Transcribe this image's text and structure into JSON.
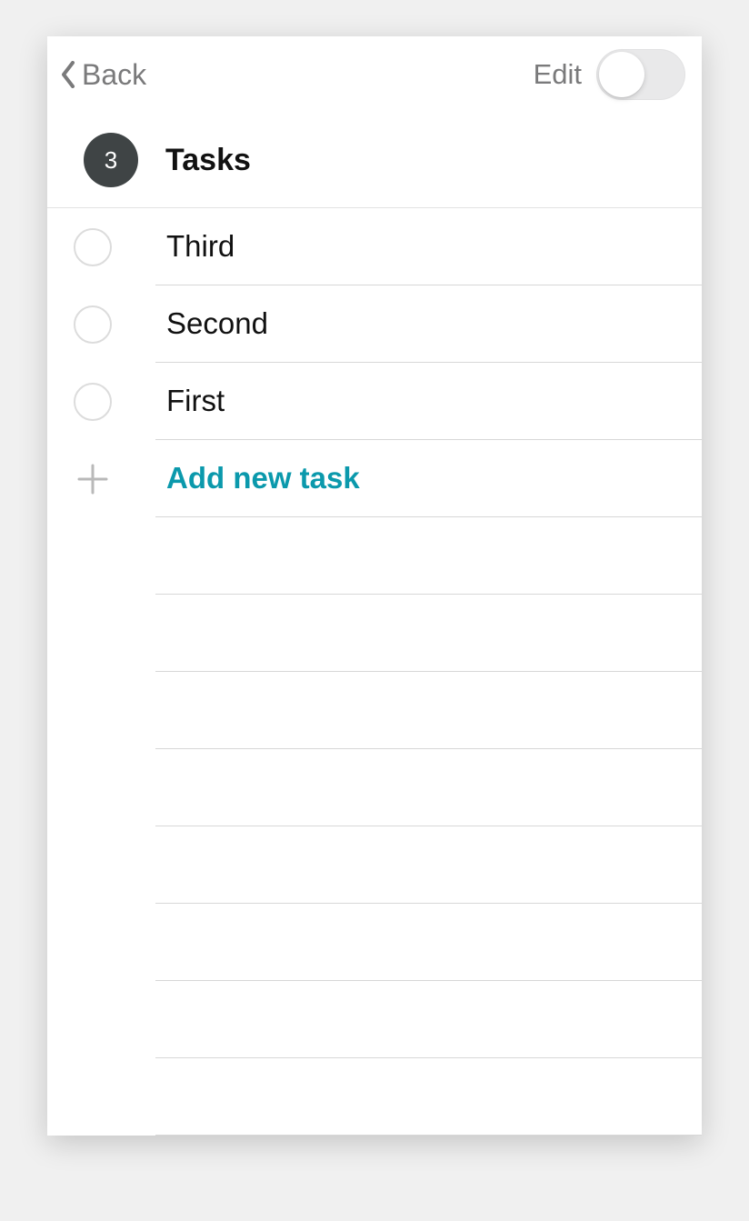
{
  "header": {
    "back_label": "Back",
    "edit_label": "Edit",
    "toggle_on": false
  },
  "title": {
    "count": "3",
    "text": "Tasks"
  },
  "tasks": [
    {
      "label": "Third"
    },
    {
      "label": "Second"
    },
    {
      "label": "First"
    }
  ],
  "add_task": {
    "label": "Add new task"
  },
  "colors": {
    "accent": "#0b99ac",
    "badge_bg": "#3f4445",
    "muted_text": "#7a7a7b",
    "divider": "#d7d7d7"
  },
  "empty_line_count": 8
}
